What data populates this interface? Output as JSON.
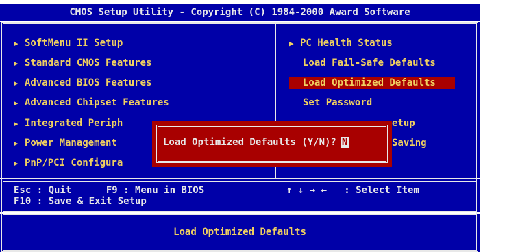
{
  "title": "CMOS Setup Utility - Copyright (C) 1984-2000 Award Software",
  "left_menu": [
    {
      "label": "SoftMenu II Setup",
      "arrow": true
    },
    {
      "label": "Standard CMOS Features",
      "arrow": true
    },
    {
      "label": "Advanced BIOS Features",
      "arrow": true
    },
    {
      "label": "Advanced Chipset Features",
      "arrow": true
    },
    {
      "label": "Integrated Periph",
      "arrow": true
    },
    {
      "label": "Power Management",
      "arrow": true
    },
    {
      "label": "PnP/PCI Configura",
      "arrow": true
    }
  ],
  "right_menu": [
    {
      "label": "PC Health Status",
      "arrow": true
    },
    {
      "label": "Load Fail-Safe Defaults",
      "arrow": false
    },
    {
      "label": "Load Optimized Defaults",
      "arrow": false,
      "selected": true
    },
    {
      "label": "Set Password",
      "arrow": false
    },
    {
      "label": "etup",
      "arrow": false
    },
    {
      "label": "Saving",
      "arrow": false
    }
  ],
  "help": {
    "esc": "Esc : Quit      F9 : Menu in BIOS",
    "f10": "F10 : Save & Exit Setup",
    "arrows": "↑ ↓ → ←   : Select Item"
  },
  "status_text": "Load Optimized Defaults",
  "dialog": {
    "prompt": "Load Optimized Defaults (Y/N)?",
    "answer": "N"
  },
  "colors": {
    "background_blue": "#0000a8",
    "text_yellow": "#f0d060",
    "highlight_red": "#a80000",
    "text_white": "#e8e8e8"
  }
}
